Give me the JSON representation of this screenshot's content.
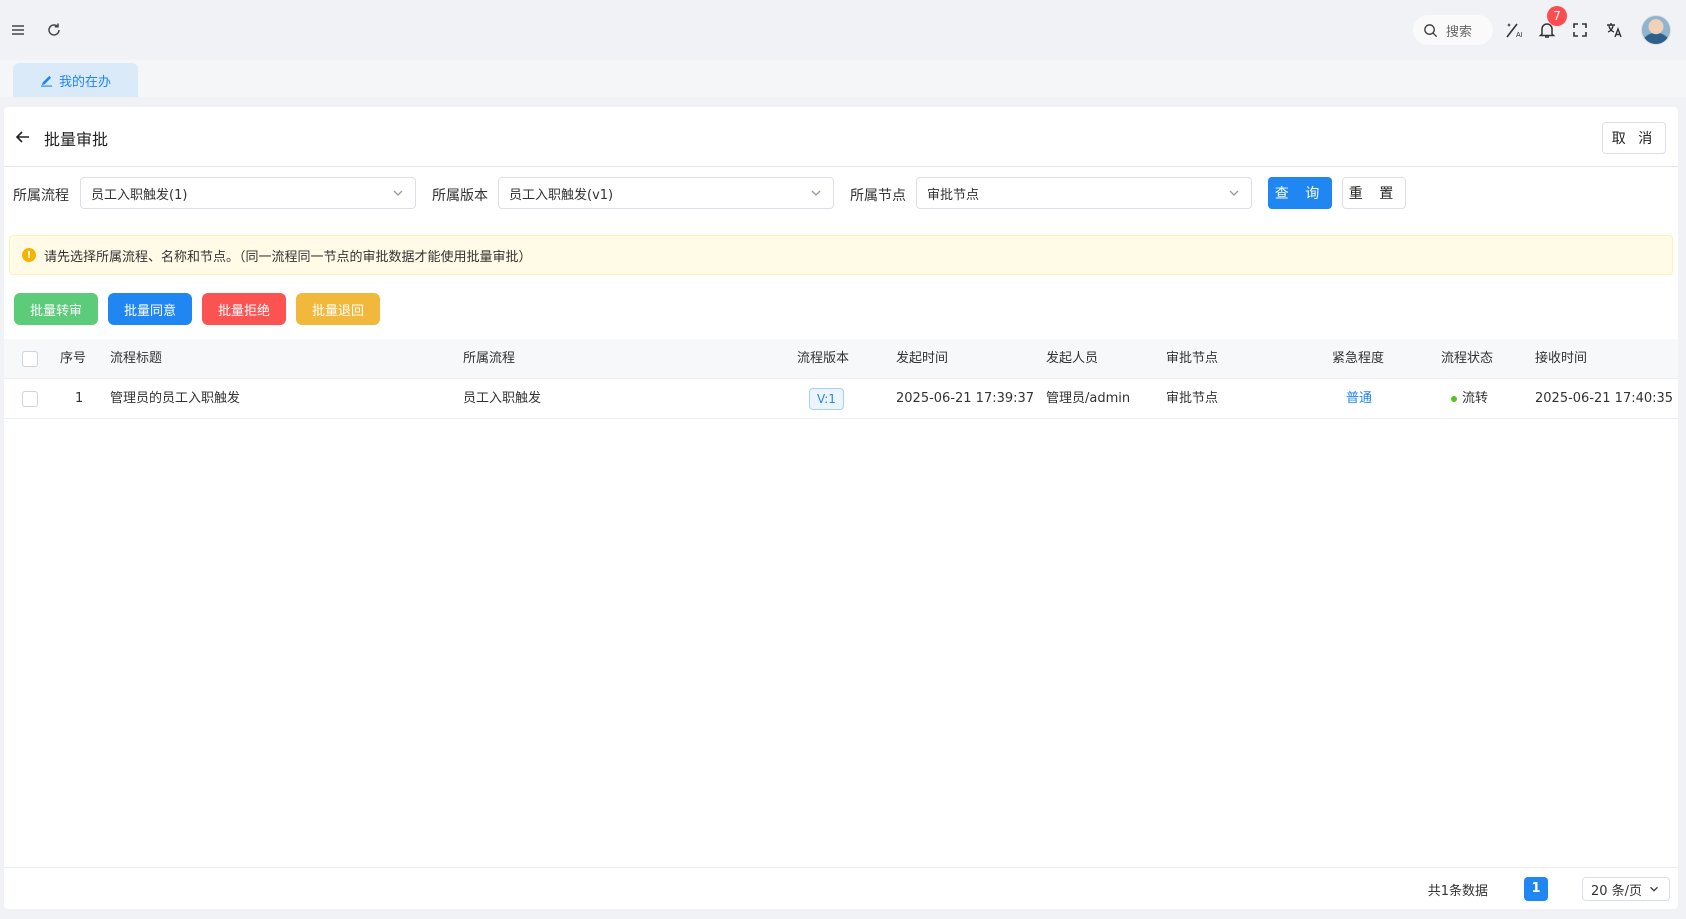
{
  "header": {
    "search_label": "搜索",
    "notification_count": "7"
  },
  "tabs": [
    {
      "label": "我的在办",
      "active": true
    }
  ],
  "page": {
    "title": "批量审批",
    "cancel_label": "取 消"
  },
  "filters": {
    "process_label": "所属流程",
    "process_value": "员工入职触发(1)",
    "version_label": "所属版本",
    "version_value": "员工入职触发(v1)",
    "node_label": "所属节点",
    "node_value": "审批节点",
    "query_label": "查 询",
    "reset_label": "重 置"
  },
  "notice": "请先选择所属流程、名称和节点。（同一流程同一节点的审批数据才能使用批量审批）",
  "actions": [
    {
      "label": "批量转审",
      "color": "#5ccb7a"
    },
    {
      "label": "批量同意",
      "color": "#1f86f2"
    },
    {
      "label": "批量拒绝",
      "color": "#fb5252"
    },
    {
      "label": "批量退回",
      "color": "#f2b83c"
    }
  ],
  "table": {
    "columns": [
      "序号",
      "流程标题",
      "所属流程",
      "流程版本",
      "发起时间",
      "发起人员",
      "审批节点",
      "紧急程度",
      "流程状态",
      "接收时间"
    ],
    "rows": [
      {
        "index": "1",
        "title": "管理员的员工入职触发",
        "process": "员工入职触发",
        "version": "V:1",
        "start_time": "2025-06-21 17:39:37",
        "initiator": "管理员/admin",
        "node": "审批节点",
        "urgency": "普通",
        "status": "流转",
        "receive_time": "2025-06-21 17:40:35"
      }
    ]
  },
  "pagination": {
    "total": "共1条数据",
    "current": "1",
    "page_size": "20 条/页"
  },
  "colors": {
    "primary": "#1f86f2",
    "link": "#1f86f2",
    "status_green": "#52c41a"
  }
}
